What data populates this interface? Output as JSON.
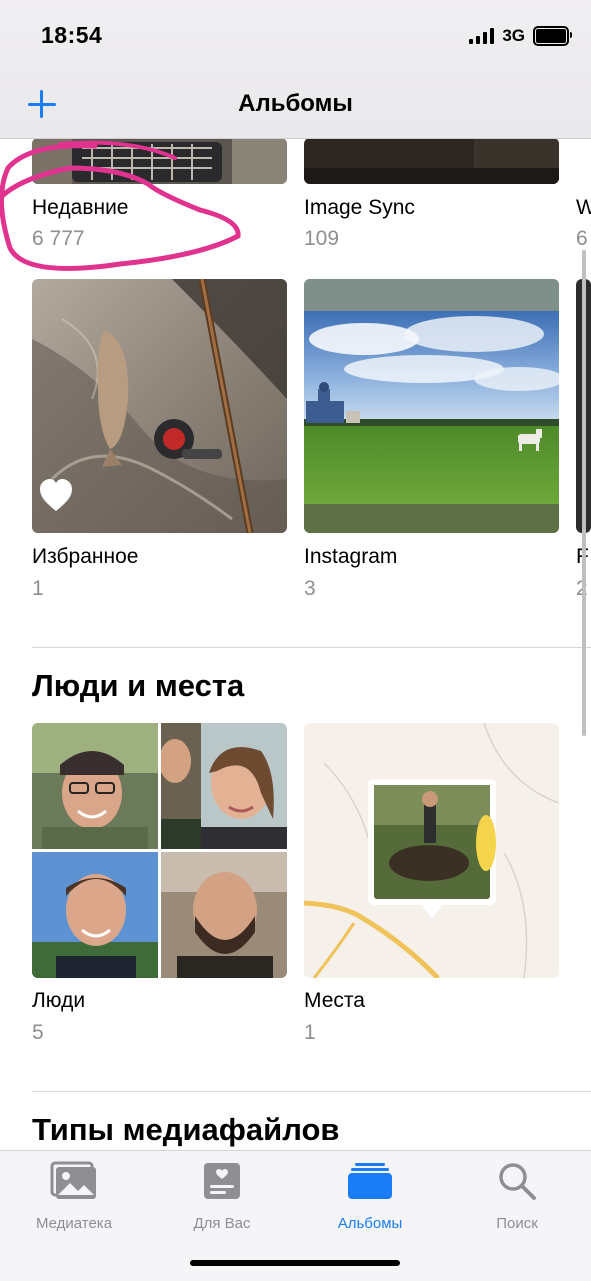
{
  "status_bar": {
    "time": "18:54",
    "network": "3G",
    "battery_level": 1.0
  },
  "nav": {
    "title": "Альбомы",
    "add_icon": "plus-icon"
  },
  "albums": [
    {
      "title": "Недавние",
      "count": "6 777"
    },
    {
      "title": "Image Sync",
      "count": "109"
    },
    {
      "title": "W",
      "count": "6"
    },
    {
      "title": "Избранное",
      "count": "1"
    },
    {
      "title": "Instagram",
      "count": "3"
    },
    {
      "title": "F",
      "count": "2"
    }
  ],
  "people_places": {
    "title": "Люди и места",
    "people": {
      "title": "Люди",
      "count": "5"
    },
    "places": {
      "title": "Места",
      "count": "1"
    }
  },
  "media_types": {
    "title": "Типы медиафайлов"
  },
  "tabs": [
    {
      "label": "Медиатека",
      "icon": "photo-library-icon"
    },
    {
      "label": "Для Вас",
      "icon": "for-you-icon"
    },
    {
      "label": "Альбомы",
      "icon": "albums-icon"
    },
    {
      "label": "Поиск",
      "icon": "search-icon"
    }
  ],
  "colors": {
    "accent": "#1a7cf6",
    "secondary_text": "#8e8e93",
    "annotation": "#e0338f"
  }
}
